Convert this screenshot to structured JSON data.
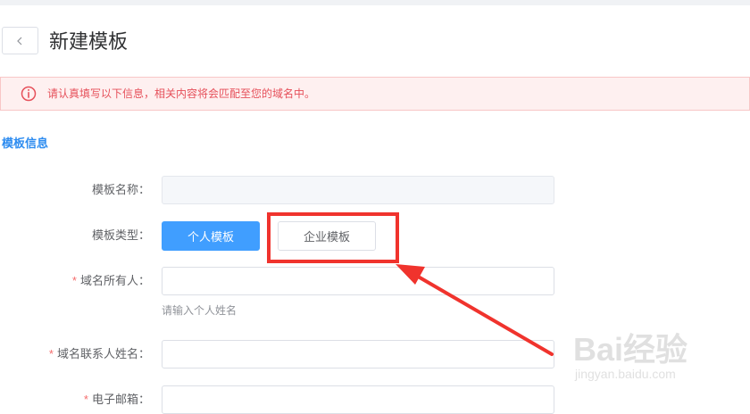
{
  "header": {
    "back_button_label": "‹",
    "title": "新建模板"
  },
  "alert": {
    "icon": "info-circle-icon",
    "text": "请认真填写以下信息，相关内容将会匹配至您的域名中。"
  },
  "section": {
    "title": "模板信息"
  },
  "form": {
    "template_name": {
      "label": "模板名称：",
      "value": "",
      "required": false
    },
    "template_type": {
      "label": "模板类型：",
      "options": [
        "个人模板",
        "企业模板"
      ],
      "selected": "个人模板"
    },
    "domain_owner": {
      "label": "域名所有人：",
      "required": true,
      "required_mark": "*",
      "value": "",
      "hint": "请输入个人姓名"
    },
    "contact_name": {
      "label": "域名联系人姓名：",
      "required": true,
      "required_mark": "*",
      "value": ""
    },
    "email": {
      "label": "电子邮箱：",
      "required": true,
      "required_mark": "*",
      "value": ""
    }
  },
  "watermark": {
    "brand": "Bai经验",
    "url": "jingyan.baidu.com"
  },
  "colors": {
    "primary": "#409eff",
    "alert_text": "#e6505a",
    "alert_bg": "#fef0f0",
    "section_title": "#2d8cf0",
    "annotation": "#f0332d"
  }
}
